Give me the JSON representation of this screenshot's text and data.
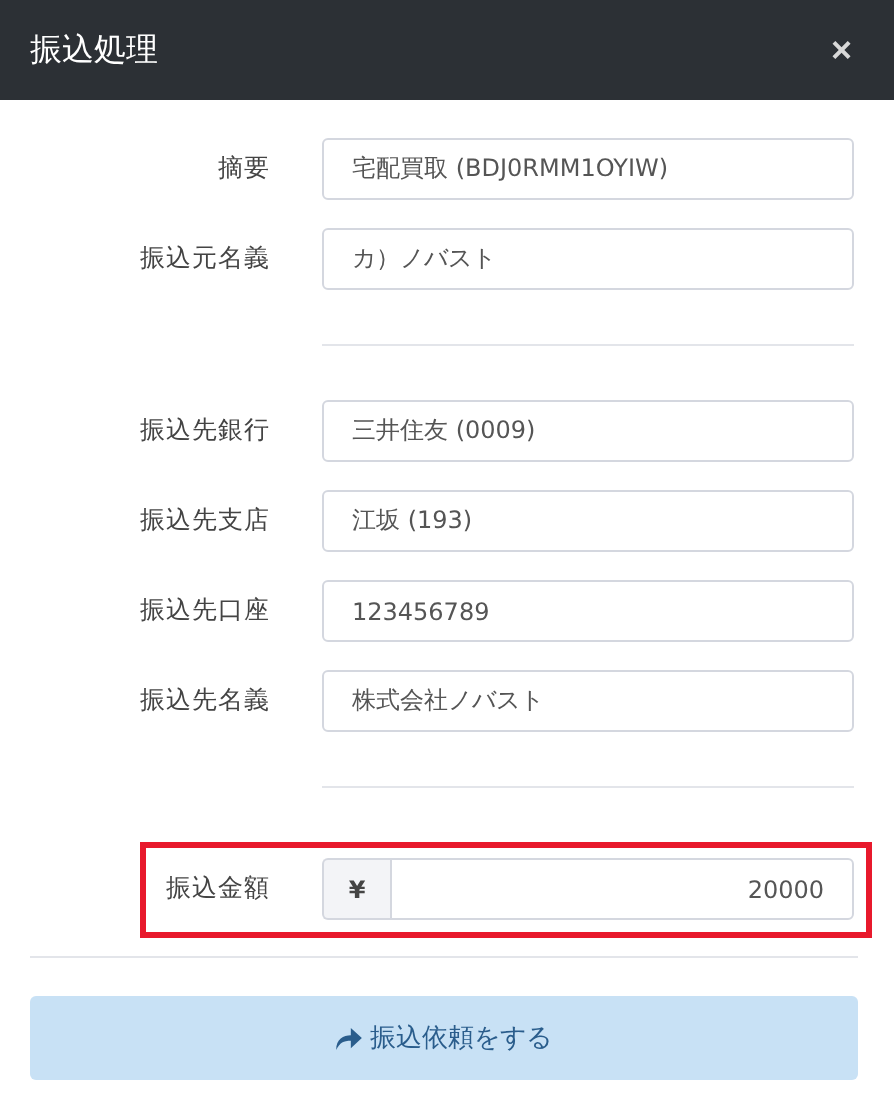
{
  "dialog": {
    "title": "振込処理",
    "close": "×"
  },
  "sections": [
    {
      "fields": [
        {
          "label": "摘要",
          "value": "宅配買取 (BDJ0RMM1OYIW)"
        },
        {
          "label": "振込元名義",
          "value": "カ）ノバスト"
        }
      ]
    },
    {
      "fields": [
        {
          "label": "振込先銀行",
          "value": "三井住友 (0009)"
        },
        {
          "label": "振込先支店",
          "value": "江坂 (193)"
        },
        {
          "label": "振込先口座",
          "value": "123456789"
        },
        {
          "label": "振込先名義",
          "value": "株式会社ノバスト"
        }
      ]
    }
  ],
  "amount": {
    "label": "振込金額",
    "prefix": "¥",
    "value": "20000",
    "highlighted": true
  },
  "submit": {
    "label": "振込依頼をする"
  }
}
